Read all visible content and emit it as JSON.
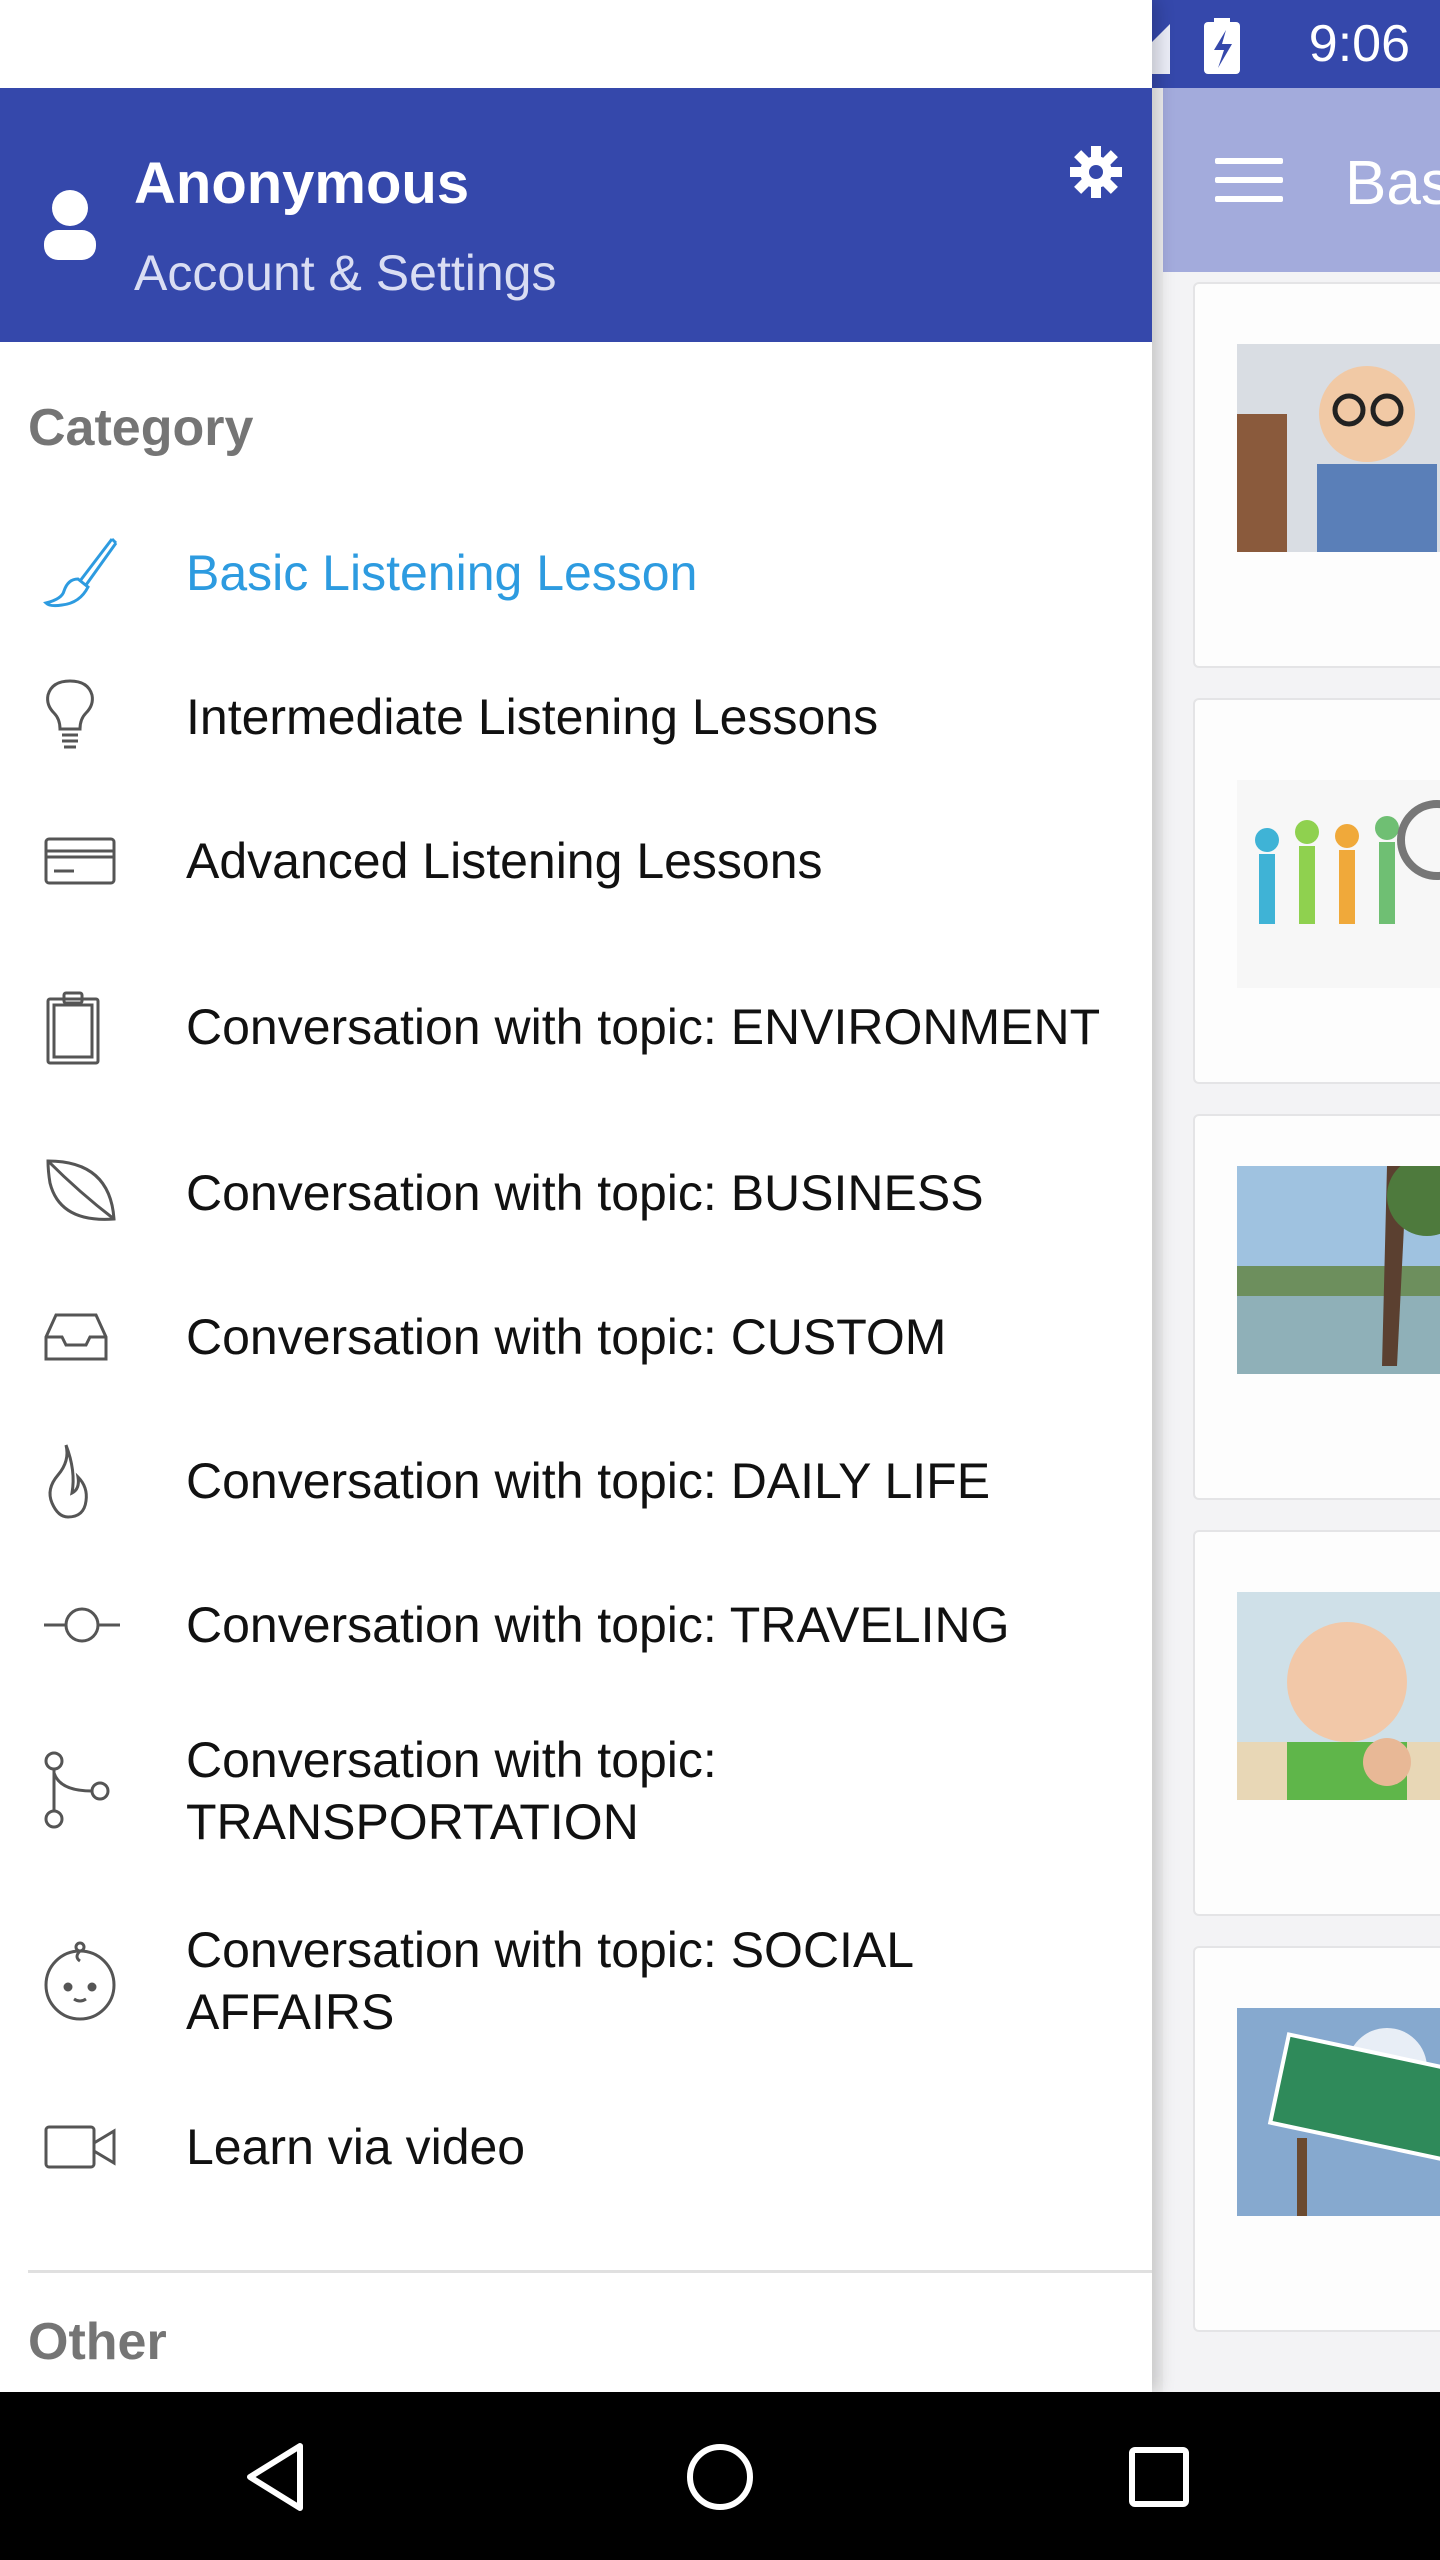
{
  "status_bar": {
    "time": "9:06"
  },
  "background": {
    "toolbar_title": "Bas"
  },
  "drawer": {
    "header": {
      "name": "Anonymous",
      "subtitle": "Account & Settings"
    },
    "category_title": "Category",
    "other_title": "Other",
    "items": [
      {
        "label": "Basic Listening Lesson",
        "icon": "paintbrush-icon",
        "active": true
      },
      {
        "label": "Intermediate Listening Lessons",
        "icon": "lightbulb-icon"
      },
      {
        "label": "Advanced Listening Lessons",
        "icon": "credit-card-icon"
      },
      {
        "label": "Conversation with topic: ENVIRONMENT",
        "icon": "clipboard-icon"
      },
      {
        "label": "Conversation with topic: BUSINESS",
        "icon": "leaf-icon"
      },
      {
        "label": "Conversation with topic: CUSTOM",
        "icon": "inbox-icon"
      },
      {
        "label": "Conversation with topic: DAILY LIFE",
        "icon": "flame-icon"
      },
      {
        "label": "Conversation with topic: TRAVELING",
        "icon": "commit-icon"
      },
      {
        "label": "Conversation with topic: TRANSPORTATION",
        "icon": "branch-icon"
      },
      {
        "label": "Conversation with topic: SOCIAL AFFAIRS",
        "icon": "baby-face-icon"
      },
      {
        "label": "Learn via video",
        "icon": "video-camera-icon"
      }
    ]
  },
  "colors": {
    "primary": "#3548ab",
    "accent": "#2d9be0"
  }
}
